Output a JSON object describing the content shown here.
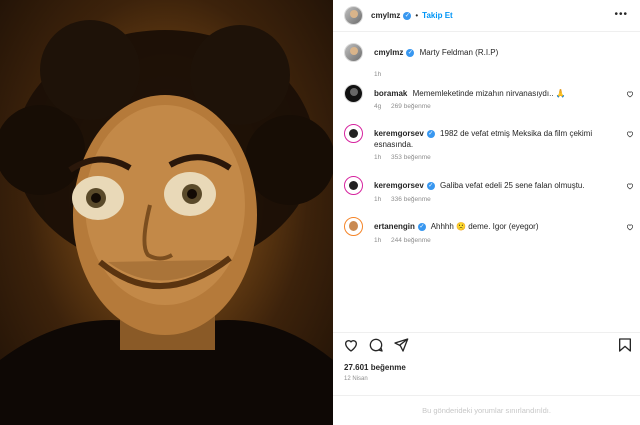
{
  "post": {
    "image_alt": "Black-and-white-sepia portrait of a smiling man with curly hair",
    "author": "cmylmz",
    "follow_label": "Takip Et",
    "dot": "•",
    "caption": "Marty Feldman (R.I.P)",
    "caption_time": "1h"
  },
  "comments": [
    {
      "user": "boramak",
      "text": "Mememleketinde mizahın nirvanasıydı.. 🙏",
      "time": "4g",
      "likes": "269 beğenme"
    },
    {
      "user": "keremgorsev",
      "text": "1982 de vefat etmiş Meksika da film çekimi esnasında.",
      "time": "1h",
      "likes": "353 beğenme"
    },
    {
      "user": "keremgorsev",
      "text": "Galiba vefat edeli 25 sene falan olmuştu.",
      "time": "1h",
      "likes": "336 beğenme"
    },
    {
      "user": "ertanengin",
      "text": "Ahhhh 🙁 deme. Igor (eyegor)",
      "time": "1h",
      "likes": "244 beğenme"
    }
  ],
  "likes_count": "27.601 beğenme",
  "post_date": "12 Nisan",
  "footer_note": "Bu gönderideki yorumlar sınırlandırıldı.",
  "icons": {
    "like": "heart-icon",
    "comment": "comment-icon",
    "share": "send-icon",
    "save": "bookmark-icon",
    "more": "more-options-icon",
    "verified": "verified-badge-icon"
  },
  "colors": {
    "link_blue": "#0095f6",
    "verified_blue": "#3897f0",
    "muted_text": "#8e8e8e"
  }
}
